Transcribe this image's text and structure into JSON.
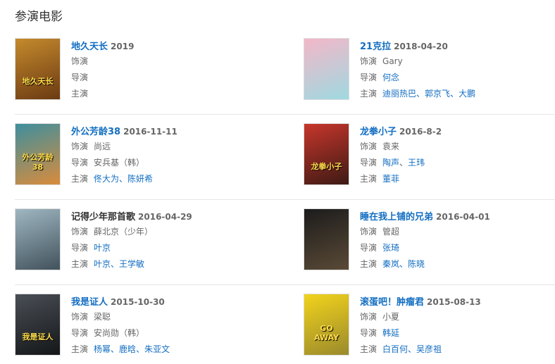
{
  "section_title": "参演电影",
  "labels": {
    "role": "饰演",
    "director": "导演",
    "cast": "主演"
  },
  "films": [
    {
      "title": "地久天长",
      "title_linked": true,
      "date": "2019",
      "role": "",
      "directors": [],
      "director_note": "",
      "cast": [],
      "poster": {
        "colors": [
          "#c48a2d",
          "#6b3a12"
        ],
        "text": "地久天长"
      }
    },
    {
      "title": "21克拉",
      "title_linked": true,
      "date": "2018-04-20",
      "role": "Gary",
      "directors": [
        "何念"
      ],
      "director_note": "",
      "cast": [
        "迪丽热巴",
        "郭京飞",
        "大鹏"
      ],
      "poster": {
        "colors": [
          "#f3b7c8",
          "#9fd9e0"
        ],
        "text": ""
      }
    },
    {
      "title": "外公芳龄38",
      "title_linked": true,
      "date": "2016-11-11",
      "role": "尚远",
      "directors": [
        "安兵基"
      ],
      "director_note": "（韩）",
      "cast": [
        "佟大为",
        "陈妍希"
      ],
      "poster": {
        "colors": [
          "#3e8f9e",
          "#d98c3c"
        ],
        "text": "外公芳龄38"
      }
    },
    {
      "title": "龙拳小子",
      "title_linked": true,
      "date": "2016-8-2",
      "role": "袁来",
      "directors": [
        "陶声",
        "王玮"
      ],
      "director_note": "",
      "cast": [
        "董菲"
      ],
      "poster": {
        "colors": [
          "#c7362c",
          "#3d1a14"
        ],
        "text": "龙拳小子"
      }
    },
    {
      "title": "记得少年那首歌",
      "title_linked": false,
      "date": "2016-04-29",
      "role": "薛北京（少年）",
      "directors": [
        "叶京"
      ],
      "director_note": "",
      "cast": [
        "叶京",
        "王学敏"
      ],
      "poster": {
        "colors": [
          "#9fb7c2",
          "#42525c"
        ],
        "text": ""
      }
    },
    {
      "title": "睡在我上铺的兄弟",
      "title_linked": true,
      "date": "2016-04-01",
      "role": "管超",
      "directors": [
        "张琦"
      ],
      "director_note": "",
      "cast": [
        "秦岚",
        "陈晓"
      ],
      "poster": {
        "colors": [
          "#1c1c1c",
          "#5a4a36"
        ],
        "text": ""
      }
    },
    {
      "title": "我是证人",
      "title_linked": true,
      "date": "2015-10-30",
      "role": "梁聪",
      "directors": [
        "安尚勋"
      ],
      "director_note": "（韩）",
      "cast": [
        "杨幂",
        "鹿晗",
        "朱亚文"
      ],
      "poster": {
        "colors": [
          "#4a4f56",
          "#141618"
        ],
        "text": "我是证人"
      }
    },
    {
      "title": "滚蛋吧！肿瘤君",
      "title_linked": true,
      "date": "2015-08-13",
      "role": "小夏",
      "directors": [
        "韩延"
      ],
      "director_note": "",
      "cast": [
        "白百何",
        "吴彦祖"
      ],
      "poster": {
        "colors": [
          "#f2d31c",
          "#9a8a2c"
        ],
        "text": "GO AWAY"
      }
    }
  ]
}
